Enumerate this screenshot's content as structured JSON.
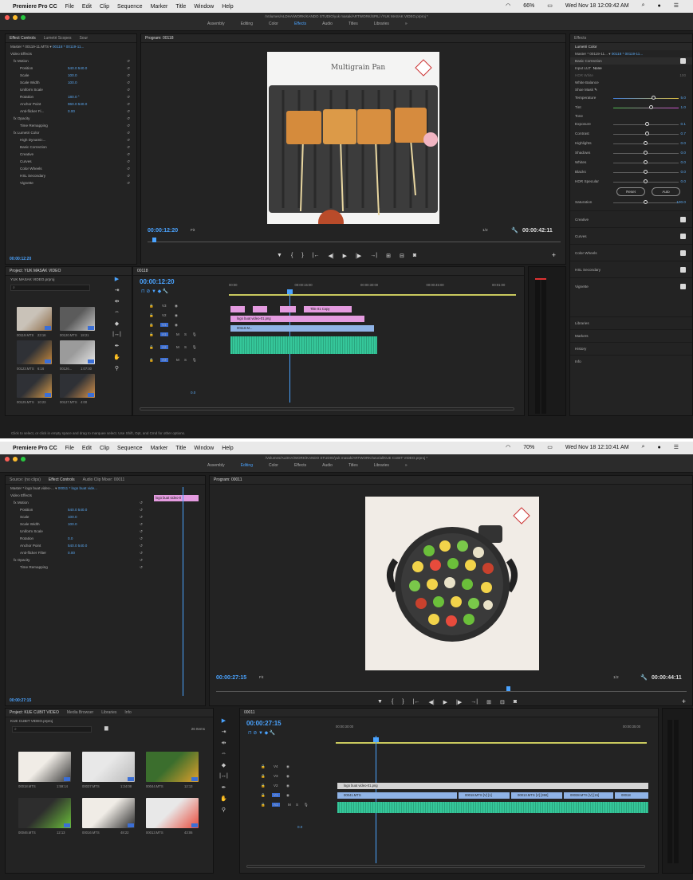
{
  "menubar": {
    "apple": "",
    "app": "Premiere Pro CC",
    "items": [
      "File",
      "Edit",
      "Clip",
      "Sequence",
      "Marker",
      "Title",
      "Window",
      "Help"
    ],
    "battery_1": "66%",
    "clock_1": "Wed Nov 18  12:09:42 AM",
    "battery_2": "70%",
    "clock_2": "Wed Nov 18  12:10:41 AM"
  },
  "workspace": {
    "path_1": "/Volumes/ALDHA/WORK/KANDO STUDIO/yuk masak/ARTWORK/SPIL/ /YUK MASAK VIDEO.prproj *",
    "path_2": "/Volumes/ALDHA/WORK/KANDO STUDIO/yuk masak/ARTWORK/tutorial/KUE CUBIT VIDEO.prproj *",
    "tabs_1": [
      "Assembly",
      "Editing",
      "Color",
      "Effects",
      "Audio",
      "Titles",
      "Libraries"
    ],
    "active_1": "Effects",
    "tabs_2": [
      "Assembly",
      "Editing",
      "Color",
      "Effects",
      "Audio",
      "Titles",
      "Libraries"
    ],
    "active_2": "Editing"
  },
  "s1": {
    "effect_controls": {
      "tabs": [
        "Effect Controls",
        "Lumetri Scopes",
        "Sour"
      ],
      "master": "Master * 00119-11.MTS",
      "clip": "00118 * 00119-11...",
      "section": "Video Effects",
      "rows": [
        {
          "label": "fx  Motion",
          "value": ""
        },
        {
          "label": "Position",
          "value": "540.0    540.0"
        },
        {
          "label": "Scale",
          "value": "100.0"
        },
        {
          "label": "Scale Width",
          "value": "100.0"
        },
        {
          "label": "Uniform Scale",
          "value": ""
        },
        {
          "label": "Rotation",
          "value": "180.0 °"
        },
        {
          "label": "Anchor Point",
          "value": "960.0    540.0"
        },
        {
          "label": "Anti-flicker Fi...",
          "value": "0.00"
        },
        {
          "label": "fx  Opacity",
          "value": ""
        },
        {
          "label": "Time Remapping",
          "value": ""
        },
        {
          "label": "fx  Lumetri Color",
          "value": ""
        },
        {
          "label": "High Dynamic...",
          "value": ""
        },
        {
          "label": "Basic Correction",
          "value": ""
        },
        {
          "label": "Creative",
          "value": ""
        },
        {
          "label": "Curves",
          "value": ""
        },
        {
          "label": "Color Wheels",
          "value": ""
        },
        {
          "label": "HSL Secondary",
          "value": ""
        },
        {
          "label": "Vignette",
          "value": ""
        }
      ],
      "timecode": "00:00:12:20"
    },
    "program": {
      "title": "Program: 00118",
      "overlay_title": "Multigrain Pan",
      "timecode": "00:00:12:20",
      "fit": "Fit",
      "ratio": "1/2",
      "duration": "00:00:42:11"
    },
    "lumetri": {
      "tabs": [
        "Effects",
        "Lumetri Color"
      ],
      "master": "Master * 00119-11...",
      "clip": "00118 * 00119-11...",
      "sections": [
        "Basic Correction",
        "Creative",
        "Curves",
        "Color Wheels",
        "HSL Secondary",
        "Vignette"
      ],
      "input_lut": "Input LUT",
      "lut_value": "None",
      "hdr_white": "HDR White",
      "hdr_val": "100",
      "white_balance": "White Balance",
      "wb_selector": "Shoe Mask",
      "tone": "Tone",
      "sliders": [
        {
          "label": "Temperature",
          "value": "5.0",
          "pos": 0.62
        },
        {
          "label": "Tint",
          "value": "1.0",
          "pos": 0.58
        },
        {
          "label": "Exposure",
          "value": "0.1",
          "pos": 0.52
        },
        {
          "label": "Contrast",
          "value": "0.7",
          "pos": 0.52
        },
        {
          "label": "Highlights",
          "value": "0.0",
          "pos": 0.5
        },
        {
          "label": "Shadows",
          "value": "0.0",
          "pos": 0.5
        },
        {
          "label": "Whites",
          "value": "0.0",
          "pos": 0.5
        },
        {
          "label": "Blacks",
          "value": "0.0",
          "pos": 0.5
        },
        {
          "label": "HDR Specular",
          "value": "0.0",
          "pos": 0.5
        },
        {
          "label": "Saturation",
          "value": "100.0",
          "pos": 0.5
        }
      ],
      "reset": "Reset",
      "auto": "Auto",
      "extra": [
        "Libraries",
        "Markers",
        "History",
        "Info"
      ]
    },
    "project": {
      "title": "Project: YUK MASAK VIDEO",
      "file": "YUK MASAK VIDEO.prproj",
      "items": [
        {
          "name": "00119.MTS",
          "dur": "23:16"
        },
        {
          "name": "00120.MTS",
          "dur": "18:21"
        },
        {
          "name": "00123.MTS",
          "dur": "6:16"
        },
        {
          "name": "00126...",
          "dur": "1:07:00"
        },
        {
          "name": "00125.MTS",
          "dur": "10:23"
        },
        {
          "name": "00127.MTS",
          "dur": "4:00"
        }
      ]
    },
    "timeline": {
      "title": "00118",
      "timecode": "00:00:12:20",
      "ruler": [
        "00:00",
        "00:00:15:00",
        "00:00:30:00",
        "00:00:45:00",
        "00:01:00"
      ],
      "tracks_v": [
        "V3",
        "V2",
        "V1"
      ],
      "tracks_a": [
        "A1",
        "A2",
        "A3"
      ],
      "clips": [
        "Title 01 Copy",
        "logo buat video-01.png",
        "00118.M..."
      ],
      "master": "0.0"
    },
    "status": "Click to select, or click in empty space and drag to marquee select. Use Shift, Opt, and Cmd for other options."
  },
  "s2": {
    "effect_controls": {
      "tabs": [
        "Source: (no clips)",
        "Effect Controls",
        "Audio Clip Mixer: 00011"
      ],
      "master": "Master * logo buat video-...",
      "clip": "00011 * logo buat vide...",
      "mini_clip": "logo buat video-0",
      "section": "Video Effects",
      "rows": [
        {
          "label": "fx  Motion",
          "value": ""
        },
        {
          "label": "Position",
          "value": "540.0    540.0"
        },
        {
          "label": "Scale",
          "value": "100.0"
        },
        {
          "label": "Scale Width",
          "value": "100.0"
        },
        {
          "label": "Uniform Scale",
          "value": ""
        },
        {
          "label": "Rotation",
          "value": "0.0"
        },
        {
          "label": "Anchor Point",
          "value": "540.0    540.0"
        },
        {
          "label": "Anti-flicker Filter",
          "value": "0.00"
        },
        {
          "label": "fx  Opacity",
          "value": ""
        },
        {
          "label": "Time Remapping",
          "value": ""
        }
      ],
      "timecode": "00:00:27:15"
    },
    "program": {
      "title": "Program: 00011",
      "timecode": "00:00:27:15",
      "fit": "Fit",
      "ratio": "1/2",
      "duration": "00:00:44:11"
    },
    "project": {
      "tabs": [
        "Project: KUE CUBIT VIDEO",
        "Media Browser",
        "Libraries",
        "Info"
      ],
      "file": "KUE CUBIT VIDEO.prproj",
      "count": "26 Items",
      "items": [
        {
          "name": "00018.MTS",
          "dur": "1:59:14"
        },
        {
          "name": "00037.MTS",
          "dur": "1:24:08"
        },
        {
          "name": "00044.MTS",
          "dur": "12:13"
        },
        {
          "name": "00046.MTS",
          "dur": "12:13"
        },
        {
          "name": "00016.MTS",
          "dur": "48:22"
        },
        {
          "name": "00013.MTS",
          "dur": "43:06"
        }
      ]
    },
    "timeline": {
      "title": "00011",
      "timecode": "00:00:27:15",
      "ruler": [
        "00:00:30:00",
        "00:00:35:00"
      ],
      "tracks_v": [
        "V4",
        "V3",
        "V2",
        "V1"
      ],
      "tracks_a": [
        "A1"
      ],
      "clips": [
        "logo buat video-01.png",
        "00041.MTS",
        "00018.MTS [V] [1]",
        "00013.MTS [V] [350]",
        "00038.MTS [V] [15]",
        "00018"
      ],
      "master": "0.0"
    }
  },
  "colors": {
    "accent": "#4aa3ff",
    "pink_clip": "#e49be0",
    "blue_clip": "#8fb3e6",
    "audio_clip": "#35c79a"
  }
}
